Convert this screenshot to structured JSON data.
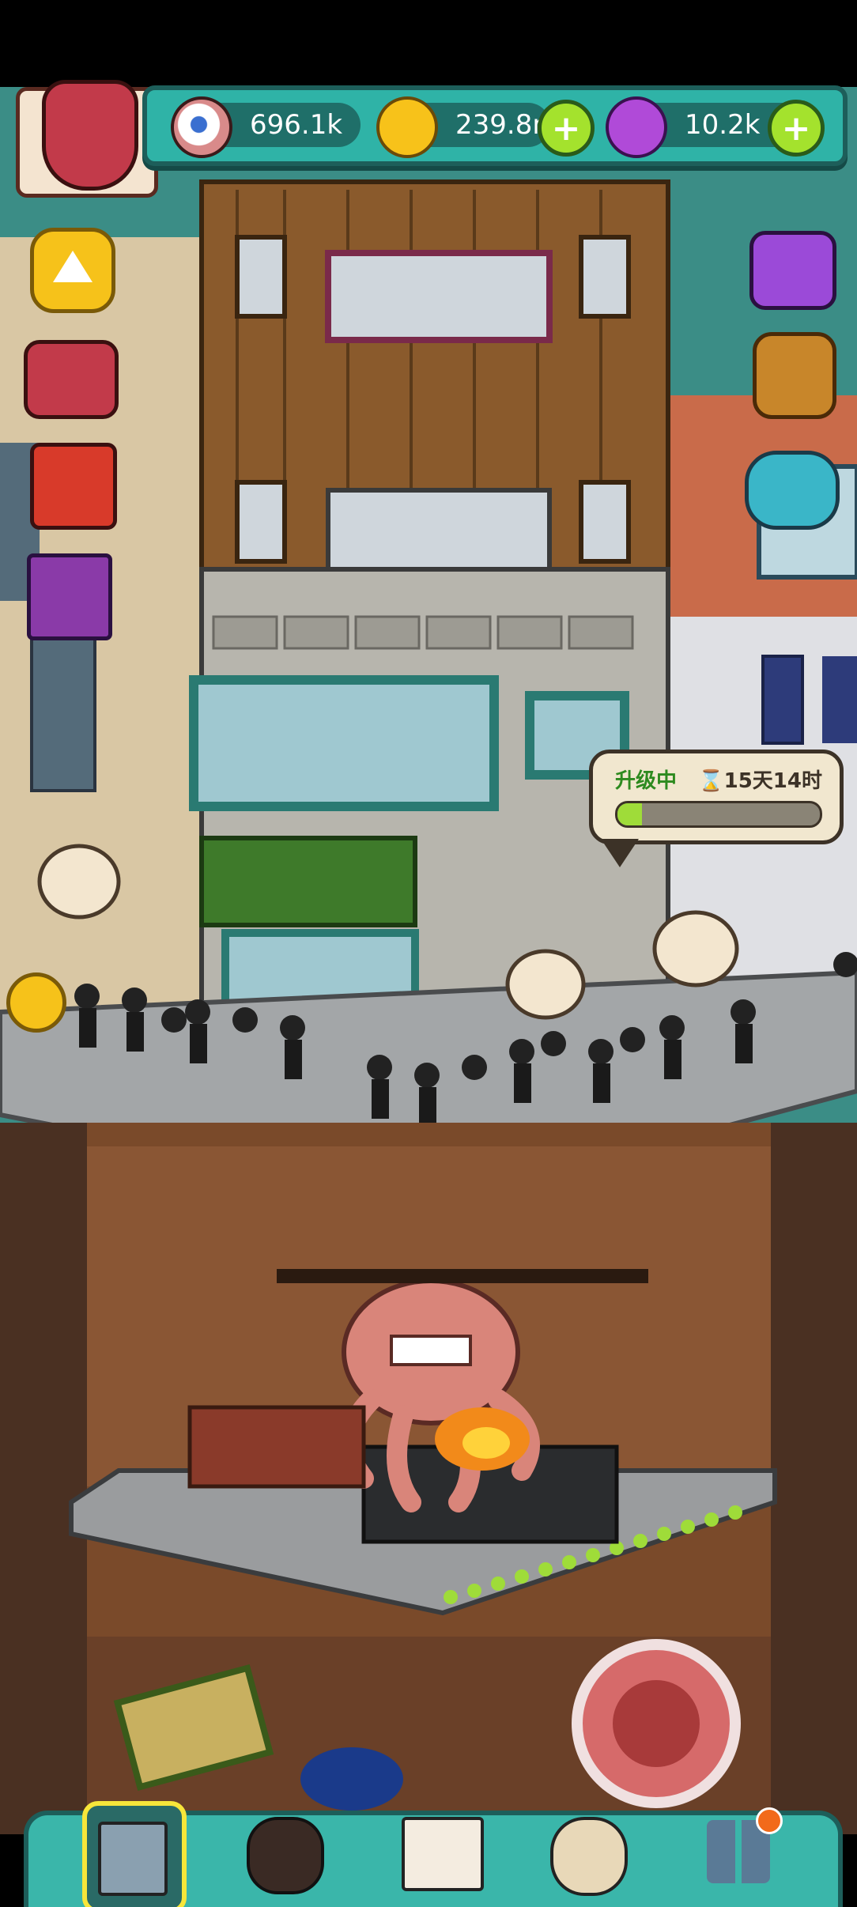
{
  "resources": {
    "eyes": "696.1k",
    "coins": "239.8m",
    "potions": "10.2k"
  },
  "upgrade": {
    "label": "升级中",
    "timer": "15天14时",
    "progress": 0.12
  },
  "colors": {
    "accent": "#2fb3a7",
    "plus": "#a4e22d",
    "progress": "#9fdc39"
  },
  "icons": {
    "eyes": "eyeball-icon",
    "coins": "gold-coin-icon",
    "potions": "purple-potion-icon"
  }
}
